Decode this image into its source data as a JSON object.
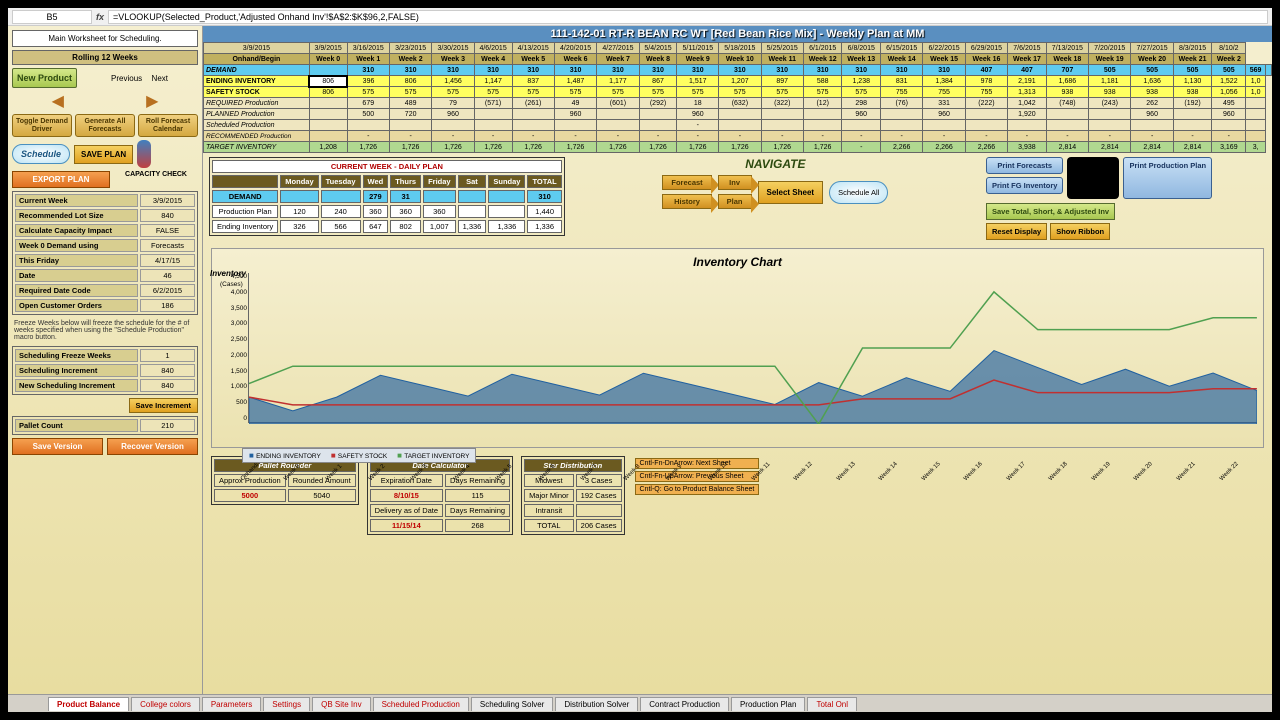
{
  "formula_bar": {
    "cell": "B5",
    "fx": "fx",
    "formula": "=VLOOKUP(Selected_Product,'Adjusted Onhand Inv'!$A$2:$K$96,2,FALSE)"
  },
  "left": {
    "info": "Main Worksheet for Scheduling.",
    "rolling": "Rolling 12 Weeks",
    "new_product": "New Product",
    "prev": "Previous",
    "next": "Next",
    "toggle": "Toggle Demand Driver",
    "generate": "Generate All Forecasts",
    "roll_cal": "Roll Forecast Calendar",
    "schedule": "Schedule",
    "save_plan": "SAVE PLAN",
    "export": "EXPORT PLAN",
    "capacity": "CAPACITY CHECK",
    "metrics": [
      [
        "Current Week",
        "3/9/2015"
      ],
      [
        "Recommended Lot Size",
        "840"
      ],
      [
        "Calculate Capacity Impact",
        "FALSE"
      ],
      [
        "Week 0 Demand using",
        "Forecasts"
      ],
      [
        "This Friday",
        "4/17/15"
      ],
      [
        "Date",
        "46"
      ],
      [
        "Required Date Code",
        "6/2/2015"
      ],
      [
        "Open Customer Orders",
        "186"
      ]
    ],
    "freeze": "Freeze Weeks below will freeze the schedule for the # of weeks specified when using the \"Schedule Production\" macro button.",
    "freeze_rows": [
      [
        "Scheduling Freeze Weeks",
        "1"
      ],
      [
        "Scheduling Increment",
        "840"
      ],
      [
        "New Scheduling Increment",
        "840"
      ]
    ],
    "save_inc": "Save Increment",
    "pallet_label": "Pallet Count",
    "pallet_count": "210",
    "save_ver": "Save Version",
    "recover_ver": "Recover Version"
  },
  "title": "111-142-01 RT-R BEAN RC WT [Red Bean Rice Mix] - Weekly Plan at MM",
  "grid": {
    "col0": "Onhand/Begin",
    "dates": [
      "3/9/2015",
      "3/9/2015",
      "3/16/2015",
      "3/23/2015",
      "3/30/2015",
      "4/6/2015",
      "4/13/2015",
      "4/20/2015",
      "4/27/2015",
      "5/4/2015",
      "5/11/2015",
      "5/18/2015",
      "5/25/2015",
      "6/1/2015",
      "6/8/2015",
      "6/15/2015",
      "6/22/2015",
      "6/29/2015",
      "7/6/2015",
      "7/13/2015",
      "7/20/2015",
      "7/27/2015",
      "8/3/2015",
      "8/10/2"
    ],
    "weeks": [
      "Week 0",
      "Week 1",
      "Week 2",
      "Week 3",
      "Week 4",
      "Week 5",
      "Week 6",
      "Week 7",
      "Week 8",
      "Week 9",
      "Week 10",
      "Week 11",
      "Week 12",
      "Week 13",
      "Week 14",
      "Week 15",
      "Week 16",
      "Week 17",
      "Week 18",
      "Week 19",
      "Week 20",
      "Week 21",
      "Week 2"
    ],
    "rows": {
      "demand": {
        "label": "DEMAND",
        "vals": [
          "",
          "310",
          "310",
          "310",
          "310",
          "310",
          "310",
          "310",
          "310",
          "310",
          "310",
          "310",
          "310",
          "310",
          "310",
          "310",
          "407",
          "407",
          "707",
          "505",
          "505",
          "505",
          "505",
          "569",
          ""
        ]
      },
      "endinv": {
        "label": "ENDING INVENTORY",
        "vals": [
          "806",
          "396",
          "806",
          "1,456",
          "1,147",
          "837",
          "1,487",
          "1,177",
          "867",
          "1,517",
          "1,207",
          "897",
          "588",
          "1,238",
          "831",
          "1,384",
          "978",
          "2,191",
          "1,686",
          "1,181",
          "1,636",
          "1,130",
          "1,522",
          "1,0"
        ]
      },
      "safety": {
        "label": "SAFETY STOCK",
        "vals": [
          "806",
          "575",
          "575",
          "575",
          "575",
          "575",
          "575",
          "575",
          "575",
          "575",
          "575",
          "575",
          "575",
          "575",
          "755",
          "755",
          "755",
          "1,313",
          "938",
          "938",
          "938",
          "938",
          "1,056",
          "1,0"
        ]
      },
      "reqprod": {
        "label": "REQUIRED Production",
        "vals": [
          "",
          "679",
          "489",
          "79",
          "(571)",
          "(261)",
          "49",
          "(601)",
          "(292)",
          "18",
          "(632)",
          "(322)",
          "(12)",
          "298",
          "(76)",
          "331",
          "(222)",
          "1,042",
          "(748)",
          "(243)",
          "262",
          "(192)",
          "495",
          ""
        ]
      },
      "planprod": {
        "label": "PLANNED Production",
        "vals": [
          "",
          "500",
          "720",
          "960",
          "",
          "",
          "960",
          "",
          "",
          "960",
          "",
          "",
          "",
          "960",
          "",
          "960",
          "",
          "1,920",
          "",
          "",
          "960",
          "",
          "960",
          ""
        ]
      },
      "schedprod": {
        "label": "Scheduled Production",
        "vals": [
          "",
          "",
          "",
          "",
          "",
          "",
          "",
          "",
          "",
          "-",
          "",
          "",
          "",
          "",
          "",
          "",
          "",
          "",
          "",
          "",
          "",
          "",
          "",
          ""
        ]
      },
      "recprod": {
        "label": "RECOMMENDED Production",
        "vals": [
          "",
          "-",
          "-",
          "-",
          "-",
          "-",
          "-",
          "-",
          "-",
          "-",
          "-",
          "-",
          "-",
          "-",
          "-",
          "-",
          "-",
          "-",
          "-",
          "-",
          "-",
          "-",
          "-",
          ""
        ]
      },
      "target": {
        "label": "TARGET INVENTORY",
        "vals": [
          "1,208",
          "1,726",
          "1,726",
          "1,726",
          "1,726",
          "1,726",
          "1,726",
          "1,726",
          "1,726",
          "1,726",
          "1,726",
          "1,726",
          "1,726",
          "-",
          "2,266",
          "2,266",
          "2,266",
          "3,938",
          "2,814",
          "2,814",
          "2,814",
          "2,814",
          "3,169",
          "3,"
        ]
      }
    }
  },
  "daily": {
    "title": "CURRENT WEEK - DAILY PLAN",
    "days": [
      "",
      "Monday",
      "Tuesday",
      "Wed",
      "Thurs",
      "Friday",
      "Sat",
      "Sunday",
      "TOTAL"
    ],
    "demand": [
      "DEMAND",
      "",
      "",
      "279",
      "31",
      "",
      "",
      "",
      "310"
    ],
    "plan": [
      "Production Plan",
      "120",
      "240",
      "360",
      "360",
      "360",
      "",
      "",
      "1,440"
    ],
    "end": [
      "Ending Inventory",
      "326",
      "566",
      "647",
      "802",
      "1,007",
      "1,336",
      "1,336",
      "1,336"
    ]
  },
  "nav": {
    "title": "NAVIGATE",
    "forecast": "Forecast",
    "inv": "Inv",
    "history": "History",
    "plan": "Plan",
    "select": "Select Sheet",
    "sched_all": "Schedule All",
    "print_fc": "Print Forecasts",
    "print_fg": "Print FG Inventory",
    "print_pp": "Print Production Plan",
    "save_total": "Save Total, Short, & Adjusted Inv",
    "reset": "Reset Display",
    "show_ribbon": "Show Ribbon"
  },
  "chart_data": {
    "type": "line-area",
    "title": "Inventory Chart",
    "ylabel": "Inventory",
    "ylabel_sub": "(Cases)",
    "ylim": [
      0,
      4500
    ],
    "yticks": [
      0,
      500,
      1000,
      1500,
      2000,
      2500,
      3000,
      3500,
      4000,
      4500
    ],
    "categories": [
      "Onhand/Begin",
      "Week 0",
      "Week 1",
      "Week 2",
      "Week 3",
      "Week 4",
      "Week 5",
      "Week 6",
      "Week 7",
      "Week 8",
      "Week 9",
      "Week 10",
      "Week 11",
      "Week 12",
      "Week 13",
      "Week 14",
      "Week 15",
      "Week 16",
      "Week 17",
      "Week 18",
      "Week 19",
      "Week 20",
      "Week 21",
      "Week 22"
    ],
    "series": [
      {
        "name": "ENDING INVENTORY",
        "type": "area",
        "color": "#2060a0",
        "values": [
          806,
          396,
          806,
          1456,
          1147,
          837,
          1487,
          1177,
          867,
          1517,
          1207,
          897,
          588,
          1238,
          831,
          1384,
          978,
          2191,
          1686,
          1181,
          1636,
          1130,
          1522,
          1000
        ]
      },
      {
        "name": "SAFETY STOCK",
        "type": "line",
        "color": "#c03030",
        "values": [
          806,
          575,
          575,
          575,
          575,
          575,
          575,
          575,
          575,
          575,
          575,
          575,
          575,
          575,
          755,
          755,
          755,
          1313,
          938,
          938,
          938,
          938,
          1056,
          1056
        ]
      },
      {
        "name": "TARGET INVENTORY",
        "type": "line",
        "color": "#50a050",
        "values": [
          1208,
          1726,
          1726,
          1726,
          1726,
          1726,
          1726,
          1726,
          1726,
          1726,
          1726,
          1726,
          1726,
          0,
          2266,
          2266,
          2266,
          3938,
          2814,
          2814,
          2814,
          2814,
          3169,
          3169
        ]
      }
    ]
  },
  "pallet_rounder": {
    "title": "Pallet Rounder",
    "h1": "Approx Production",
    "h2": "Rounded Amount",
    "v1": "5000",
    "v2": "5040"
  },
  "date_calc": {
    "title": "Date Calculator",
    "h1": "Expiration Date",
    "h2": "Days Remaining",
    "r1a": "8/10/15",
    "r1b": "115",
    "h3": "Delivery as of Date",
    "h4": "Days Remaining",
    "r2a": "11/15/14",
    "r2b": "268"
  },
  "star": {
    "h": "Star Distribution",
    "r": [
      [
        "Midwest",
        "3 Cases"
      ],
      [
        "Major Minor",
        "192 Cases"
      ],
      [
        "Intransit",
        ""
      ],
      [
        "TOTAL",
        "206 Cases"
      ]
    ]
  },
  "shortcuts": [
    [
      "Cntl-Fn-DnArrow: Next Sheet"
    ],
    [
      "Cntl-Fn-UpArrow: Previous Sheet"
    ],
    [
      "Cntl-Q: Go to Product Balance Sheet"
    ]
  ],
  "tabs": [
    "Product Balance",
    "College colors",
    "Parameters",
    "Settings",
    "QB Site Inv",
    "Scheduled Production",
    "Scheduling Solver",
    "Distribution Solver",
    "Contract Production",
    "Production Plan",
    "Total Onl"
  ]
}
